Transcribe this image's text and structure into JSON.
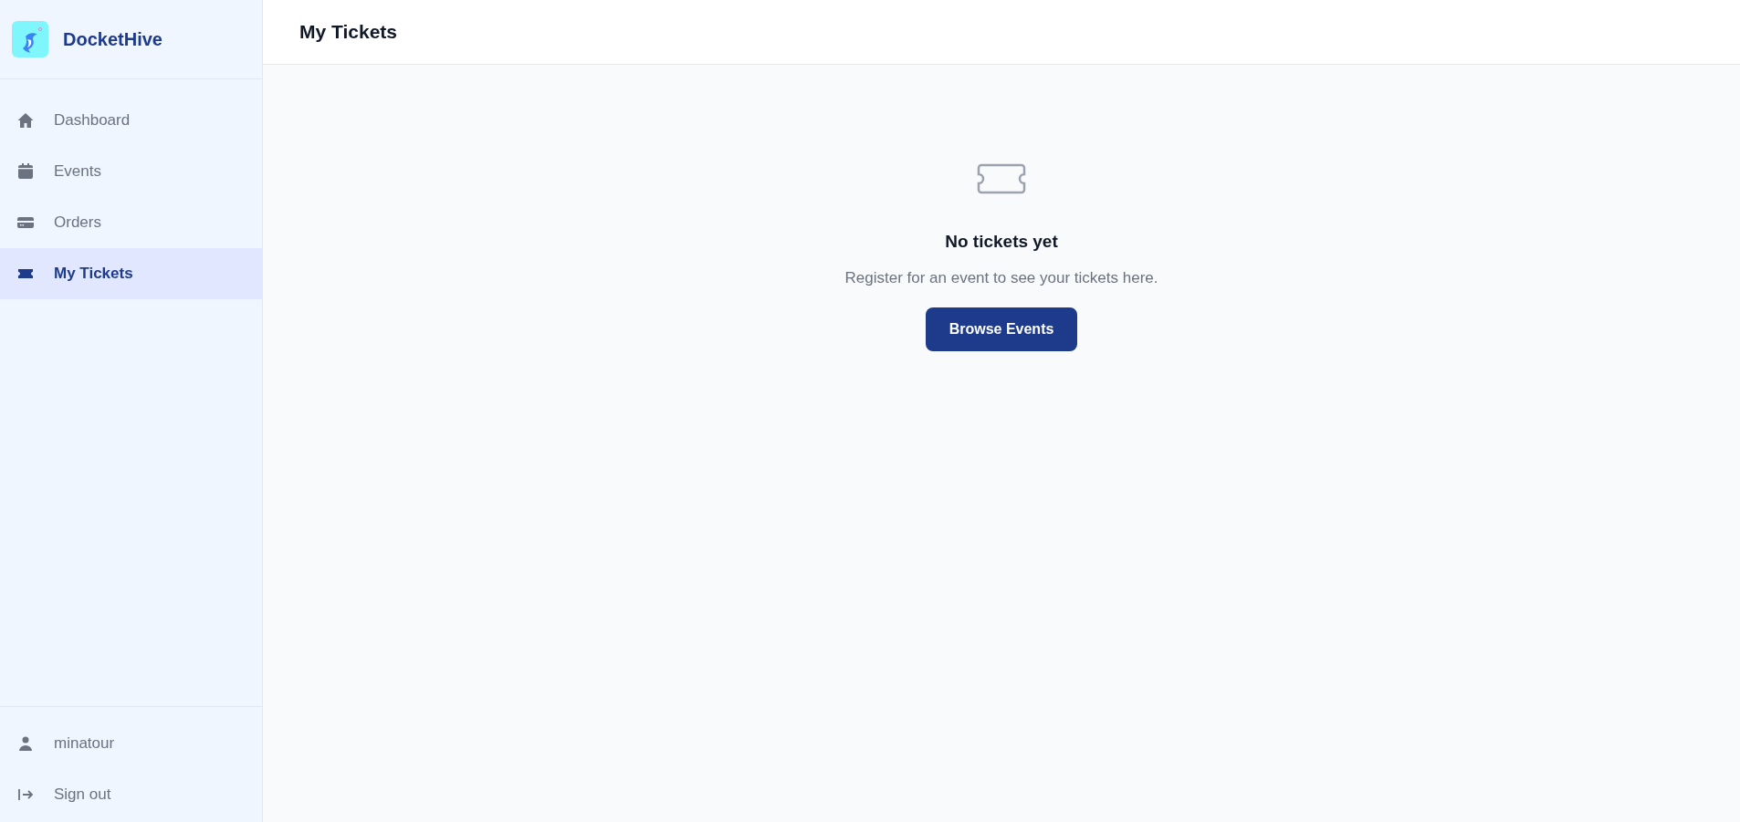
{
  "sidebar": {
    "brand": "DocketHive",
    "items": [
      {
        "label": "Dashboard",
        "kind": "home",
        "selected": false
      },
      {
        "label": "Events",
        "kind": "calendar",
        "selected": false
      },
      {
        "label": "Orders",
        "kind": "card",
        "selected": false
      },
      {
        "label": "My Tickets",
        "kind": "ticket",
        "selected": true
      }
    ],
    "footer": [
      {
        "label": "minatour",
        "kind": "user"
      },
      {
        "label": "Sign out",
        "kind": "signout"
      }
    ]
  },
  "header": {
    "title": "My Tickets"
  },
  "empty_state": {
    "title": "No tickets yet",
    "message": "Register for an event to see your tickets here.",
    "button": "Browse Events"
  }
}
